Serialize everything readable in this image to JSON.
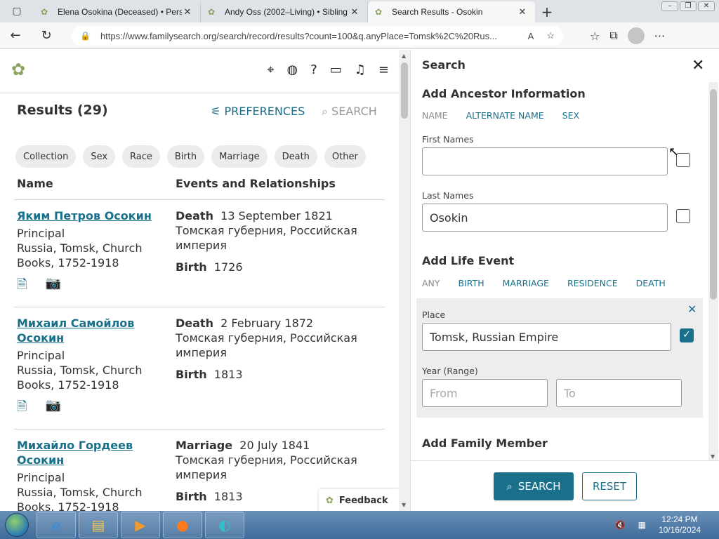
{
  "browser": {
    "tabs": [
      {
        "title": "Elena Osokina (Deceased) • Person"
      },
      {
        "title": "Andy Oss (2002–Living) • Sibling"
      },
      {
        "title": "Search Results - Osokin"
      }
    ],
    "url": "https://www.familysearch.org/search/record/results?count=100&q.anyPlace=Tomsk%2C%20Rus..."
  },
  "results": {
    "heading": "Results (29)",
    "preferences_label": "PREFERENCES",
    "search_label": "SEARCH",
    "chips": [
      "Collection",
      "Sex",
      "Race",
      "Birth",
      "Marriage",
      "Death",
      "Other"
    ],
    "col_name": "Name",
    "col_events": "Events and Relationships",
    "records": [
      {
        "name": "Яким Петров Осокин",
        "role": "Principal",
        "collection": "Russia, Tomsk, Church Books, 1752-1918",
        "event1_type": "Death",
        "event1_date": "13 September 1821",
        "event1_place": "Томская губерния, Российская империя",
        "event2_type": "Birth",
        "event2_date": "1726"
      },
      {
        "name": "Михаил Самойлов Осокин",
        "role": "Principal",
        "collection": "Russia, Tomsk, Church Books, 1752-1918",
        "event1_type": "Death",
        "event1_date": "2 February 1872",
        "event1_place": "Томская губерния, Российская империя",
        "event2_type": "Birth",
        "event2_date": "1813"
      },
      {
        "name": "Михайло Гордеев Осокин",
        "role": "Principal",
        "collection": "Russia, Tomsk, Church Books, 1752-1918",
        "event1_type": "Marriage",
        "event1_date": "20 July 1841",
        "event1_place": "Томская губерния, Российская империя",
        "event2_type": "Birth",
        "event2_date": "1813"
      }
    ],
    "feedback_label": "Feedback"
  },
  "panel": {
    "title": "Search",
    "ancestor_title": "Add Ancestor Information",
    "ancestor_tabs": [
      "NAME",
      "ALTERNATE NAME",
      "SEX"
    ],
    "first_names_label": "First Names",
    "first_names_value": "",
    "last_names_label": "Last Names",
    "last_names_value": "Osokin",
    "life_event_title": "Add Life Event",
    "life_event_tabs": [
      "ANY",
      "BIRTH",
      "MARRIAGE",
      "RESIDENCE",
      "DEATH"
    ],
    "place_label": "Place",
    "place_value": "Tomsk, Russian Empire",
    "year_label": "Year (Range)",
    "from_placeholder": "From",
    "to_placeholder": "To",
    "family_title": "Add Family Member",
    "search_button": "SEARCH",
    "reset_button": "RESET",
    "first_names_exact": false,
    "last_names_exact": false,
    "place_exact": true
  },
  "taskbar": {
    "time": "12:24 PM",
    "date": "10/16/2024"
  },
  "colors": {
    "accent": "#1a6f8a",
    "logo_green": "#8aa35e"
  }
}
